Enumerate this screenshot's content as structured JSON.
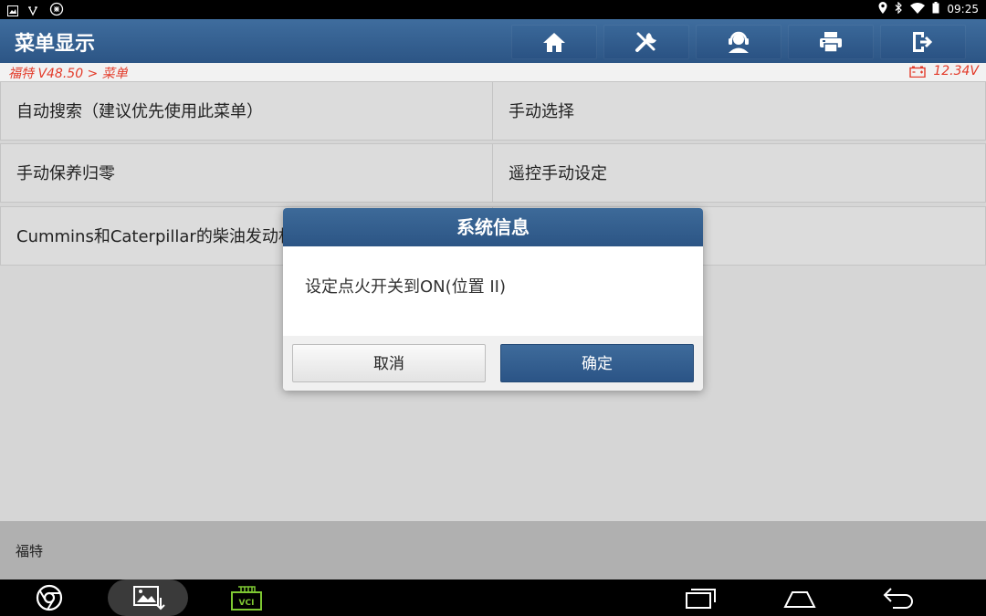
{
  "status_bar": {
    "time": "09:25"
  },
  "header": {
    "title": "菜单显示",
    "toolbar_icons": [
      "home-icon",
      "diagnose-tool-icon",
      "support-agent-icon",
      "print-icon",
      "exit-icon"
    ]
  },
  "breadcrumb": {
    "text": "福特 V48.50 > 菜单",
    "voltage": "12.34V"
  },
  "menu": {
    "items": [
      {
        "label": "自动搜索（建议优先使用此菜单）"
      },
      {
        "label": "手动选择"
      },
      {
        "label": "手动保养归零"
      },
      {
        "label": "遥控手动设定"
      },
      {
        "label": "Cummins和Caterpillar的柴油发动机"
      }
    ]
  },
  "footer": {
    "label": "福特"
  },
  "dialog": {
    "title": "系统信息",
    "message": "设定点火开关到ON(位置 II)",
    "cancel_label": "取消",
    "ok_label": "确定"
  },
  "nav_bar": {
    "vci_label": "VCI"
  },
  "colors": {
    "header_blue": "#2c5585",
    "accent_red": "#e33b2a",
    "vci_green": "#7ec832"
  }
}
